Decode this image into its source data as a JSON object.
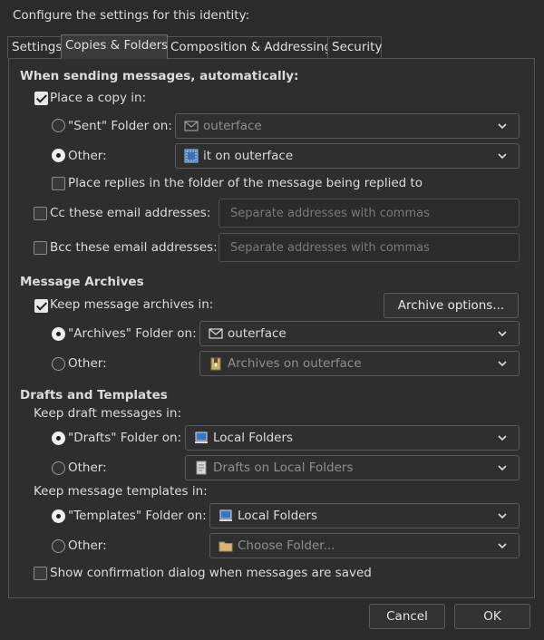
{
  "header": {
    "title": "Configure the settings for this identity:"
  },
  "tabs": [
    {
      "label": "Settings"
    },
    {
      "label": "Copies & Folders"
    },
    {
      "label": "Composition & Addressing"
    },
    {
      "label": "Security"
    }
  ],
  "sending": {
    "heading": "When sending messages, automatically:",
    "place_copy": {
      "label": "Place a copy in:",
      "checked": true
    },
    "sent_folder": {
      "label": "\"Sent\" Folder on:",
      "value": "outerface",
      "icon": "envelope-icon",
      "selected": false
    },
    "other": {
      "label": "Other:",
      "value": "it on outerface",
      "icon": "folder-blue-icon",
      "selected": true
    },
    "place_replies": {
      "label": "Place replies in the folder of the message being replied to",
      "checked": false
    },
    "cc": {
      "label": "Cc these email addresses:",
      "placeholder": "Separate addresses with commas",
      "checked": false
    },
    "bcc": {
      "label": "Bcc these email addresses:",
      "placeholder": "Separate addresses with commas",
      "checked": false
    }
  },
  "archives": {
    "heading": "Message Archives",
    "keep": {
      "label": "Keep message archives in:",
      "checked": true
    },
    "options_button": "Archive options...",
    "archives_folder": {
      "label": "\"Archives\" Folder on:",
      "value": "outerface",
      "icon": "envelope-icon",
      "selected": true
    },
    "other": {
      "label": "Other:",
      "value": "Archives on outerface",
      "icon": "archive-icon",
      "selected": false
    }
  },
  "drafts": {
    "heading": "Drafts and Templates",
    "keep_drafts": "Keep draft messages in:",
    "drafts_folder": {
      "label": "\"Drafts\" Folder on:",
      "value": "Local Folders",
      "icon": "computer-icon",
      "selected": true
    },
    "drafts_other": {
      "label": "Other:",
      "value": "Drafts on Local Folders",
      "icon": "document-icon",
      "selected": false
    },
    "keep_templates": "Keep message templates in:",
    "templates_folder": {
      "label": "\"Templates\" Folder on:",
      "value": "Local Folders",
      "icon": "computer-icon",
      "selected": true
    },
    "templates_other": {
      "label": "Other:",
      "value": "Choose Folder...",
      "icon": "folder-icon",
      "selected": false
    },
    "confirm": {
      "label": "Show confirmation dialog when messages are saved",
      "checked": false
    }
  },
  "footer": {
    "cancel": "Cancel",
    "ok": "OK"
  }
}
